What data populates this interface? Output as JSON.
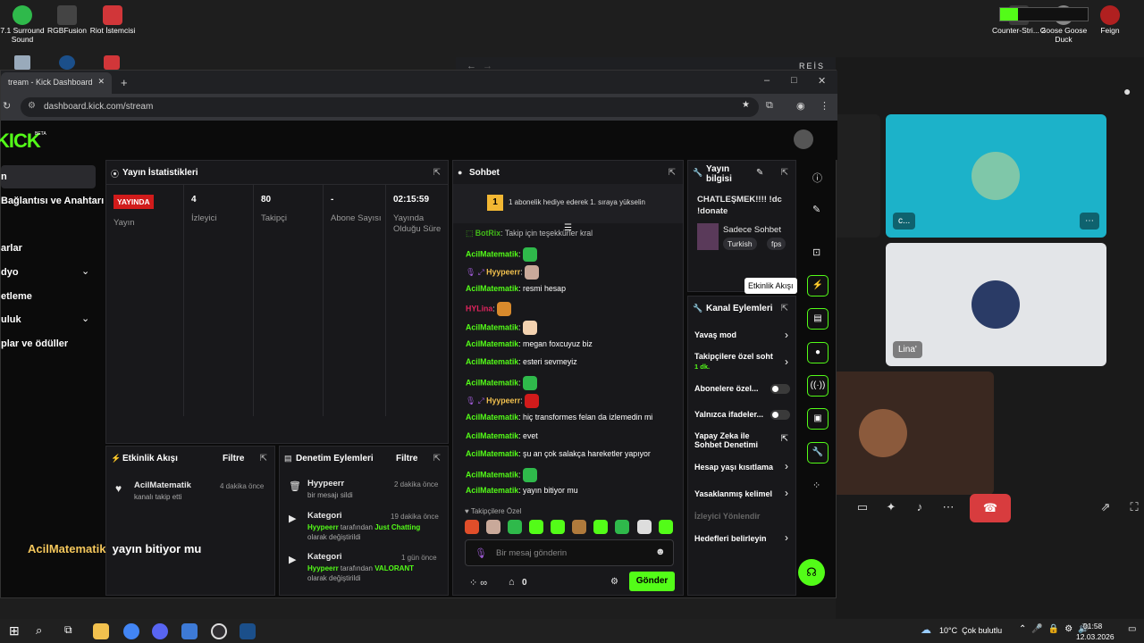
{
  "desktop": {
    "icons": [
      {
        "label": "7.1 Surround Sound"
      },
      {
        "label": "RGBFusion"
      },
      {
        "label": "Riot İstemcisi"
      },
      {
        "label": "Counter-Stri... 2"
      },
      {
        "label": "Goose Goose Duck"
      },
      {
        "label": "Feign"
      }
    ]
  },
  "discord": {
    "title": "REİS",
    "tiles": [
      {
        "name": "c..."
      },
      {
        "name": "Lina'"
      }
    ]
  },
  "browser": {
    "tab_title": "tream - Kick Dashboard",
    "url": "dashboard.kick.com/stream"
  },
  "kick": {
    "logo": "KICK",
    "beta": "BETA",
    "sidebar": [
      "n",
      "Bağlantısı ve Anahtarı",
      "arlar",
      "dyo",
      "etleme",
      "uluk",
      "plar ve ödüller"
    ],
    "stats": {
      "title": "Yayın İstatistikleri",
      "live_badge": "YAYINDA",
      "live_label": "Yayın",
      "items": [
        {
          "value": "4",
          "label": "İzleyici"
        },
        {
          "value": "80",
          "label": "Takipçi"
        },
        {
          "value": "-",
          "label": "Abone Sayısı"
        },
        {
          "value": "02:15:59",
          "label": "Yayında Olduğu Süre"
        }
      ]
    },
    "activity": {
      "title": "Etkinlik Akışı",
      "filter": "Filtre",
      "item_user": "AcilMatematik",
      "item_text": "kanalı takip etti",
      "item_time": "4 dakika önce"
    },
    "moderation": {
      "title": "Denetim Eylemleri",
      "filter": "Filtre",
      "items": [
        {
          "title": "Hyypeerr",
          "sub": "bir mesajı sildi",
          "time": "2 dakika önce"
        },
        {
          "title": "Kategori",
          "user": "Hyypeerr",
          "mid": "tarafından",
          "cat": "Just Chatting",
          "sub": "olarak değiştirildi",
          "time": "19 dakika önce"
        },
        {
          "title": "Kategori",
          "user": "Hyypeerr",
          "mid": "tarafından",
          "cat": "VALORANT",
          "sub": "olarak değiştirildi",
          "time": "1 gün önce"
        }
      ]
    },
    "overlay_caption": {
      "user": "AcilMatematik",
      "text": "yayın bitiyor mu"
    },
    "chat": {
      "title": "Sohbet",
      "goal": "1 abonelik hediye ederek 1. sıraya yükselin",
      "goal_num": "1",
      "messages": [
        {
          "user": "BotRix",
          "text": "Takip için teşekkürler kral"
        },
        {
          "user": "AcilMatematik",
          "text": ""
        },
        {
          "user": "Hyypeerr",
          "text": ""
        },
        {
          "user": "AcilMatematik",
          "text": "resmi hesap"
        },
        {
          "user": "HYLina",
          "text": ""
        },
        {
          "user": "AcilMatematik",
          "text": ""
        },
        {
          "user": "AcilMatematik",
          "text": "megan foxcuyuz biz"
        },
        {
          "user": "AcilMatematik",
          "text": "esteri sevmeyiz"
        },
        {
          "user": "AcilMatematik",
          "text": ""
        },
        {
          "user": "Hyypeerr",
          "text": ""
        },
        {
          "user": "AcilMatematik",
          "text": "hiç transformes felan da izlemedin mi"
        },
        {
          "user": "AcilMatematik",
          "text": "evet"
        },
        {
          "user": "AcilMatematik",
          "text": "şu an çok salakça hareketler yapıyor"
        },
        {
          "user": "AcilMatematik",
          "text": ""
        },
        {
          "user": "AcilMatematik",
          "text": "yayın bitiyor mu"
        }
      ],
      "emotes_label": "Takipçilere Özel",
      "placeholder": "Bir mesaj gönderin",
      "points": "0",
      "send": "Gönder"
    },
    "info": {
      "title": "Yayın bilgisi",
      "stream_title": "CHATLEŞMEK!!!! !dc !donate",
      "category": "Sadece Sohbet",
      "tags": [
        "Turkish",
        "fps"
      ]
    },
    "actions": {
      "title": "Kanal Eylemleri",
      "tooltip": "Etkinlik Akışı",
      "items": [
        {
          "label": "Yavaş mod"
        },
        {
          "label": "Takipçilere özel soht",
          "sub": "1 dk."
        },
        {
          "label": "Abonelere özel..."
        },
        {
          "label": "Yalnızca ifadeler..."
        },
        {
          "label": "Yapay Zeka ile Sohbet Denetimi"
        },
        {
          "label": "Hesap yaşı kısıtlama"
        },
        {
          "label": "Yasaklanmış kelimel"
        },
        {
          "label": "İzleyici Yönlendir"
        },
        {
          "label": "Hedefleri belirleyin"
        }
      ]
    }
  },
  "taskbar": {
    "weather": "10°C  Çok bulutlu",
    "time": "01:58",
    "date": "12.03.2026"
  }
}
